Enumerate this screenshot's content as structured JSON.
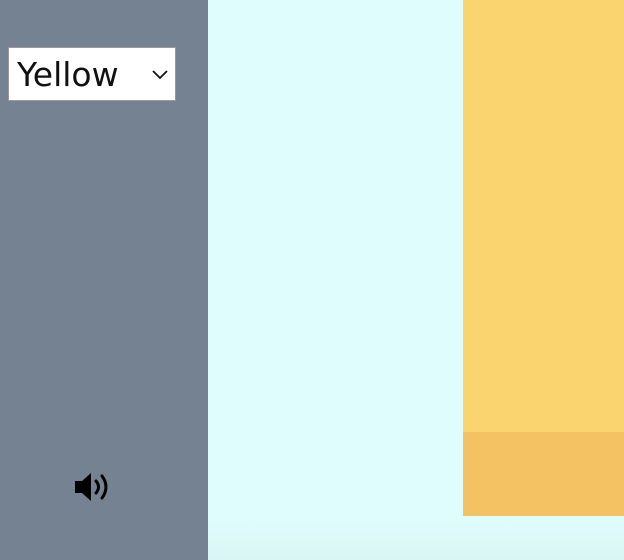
{
  "sidebar": {
    "color_select": {
      "selected": "Yellow",
      "icon": "chevron-down-icon"
    },
    "sound_toggle": {
      "icon": "speaker-volume-icon"
    }
  },
  "colors": {
    "sidebar": "#758292",
    "canvas": "#e0fdfd",
    "block_light": "#f9d46f",
    "block_dark": "#f4c262"
  }
}
